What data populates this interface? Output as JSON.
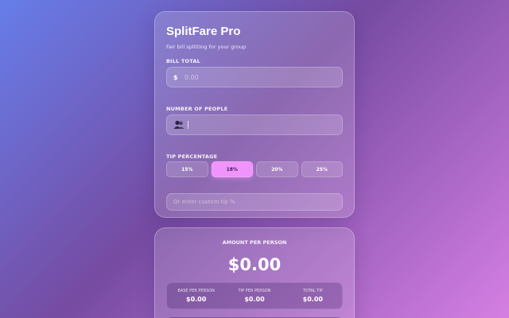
{
  "app": {
    "title": "SplitFare Pro",
    "subtitle": "Fair bill splitting for your group"
  },
  "bill": {
    "label": "BILL TOTAL",
    "currency_symbol": "$",
    "placeholder": "0.00",
    "value": ""
  },
  "people": {
    "label": "NUMBER OF PEOPLE",
    "icon": "people-icon",
    "placeholder": "",
    "value": ""
  },
  "tip": {
    "label": "TIP PERCENTAGE",
    "options": [
      "15%",
      "18%",
      "20%",
      "25%"
    ],
    "selected": "18%",
    "custom_placeholder": "Or enter custom tip %"
  },
  "result": {
    "label": "AMOUNT PER PERSON",
    "amount": "$0.00",
    "breakdown": [
      {
        "label": "BASE PER PERSON",
        "value": "$0.00"
      },
      {
        "label": "TIP PER PERSON",
        "value": "$0.00"
      },
      {
        "label": "TOTAL TIP",
        "value": "$0.00"
      }
    ]
  },
  "colors": {
    "accent": "#f093fb",
    "bg_start": "#667eea",
    "bg_mid": "#764ba2",
    "bg_end": "#d57fe3"
  }
}
